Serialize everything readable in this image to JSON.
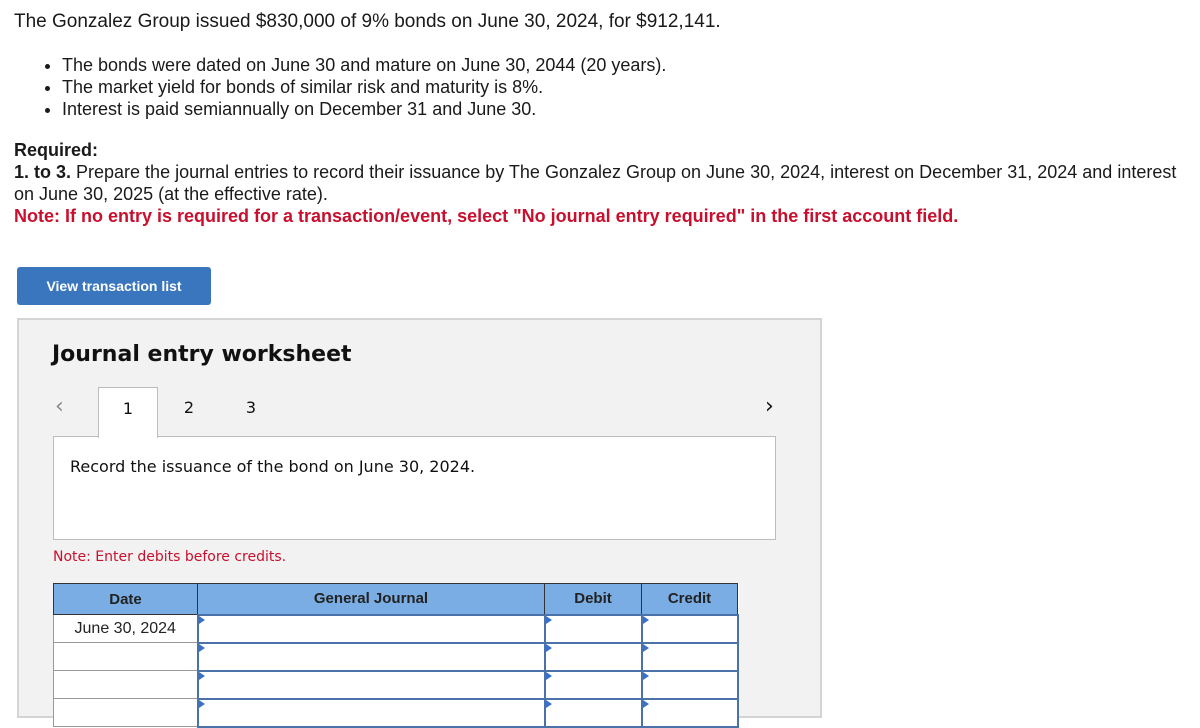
{
  "problem": {
    "intro": "The Gonzalez Group issued $830,000 of 9% bonds on June 30, 2024, for $912,141.",
    "bullets": [
      "The bonds were dated on June 30 and mature on June 30, 2044 (20 years).",
      "The market yield for bonds of similar risk and maturity is 8%.",
      "Interest is paid semiannually on December 31 and June 30."
    ],
    "required_label": "Required:",
    "step_label": "1. to 3.",
    "instruction": " Prepare the journal entries to record their issuance by The Gonzalez Group on June 30, 2024, interest on December 31, 2024 and interest on June 30, 2025 (at the effective rate).",
    "note": "Note: If no entry is required for a transaction/event, select \"No journal entry required\" in the first account field."
  },
  "buttons": {
    "view_transaction_list": "View transaction list"
  },
  "worksheet": {
    "title": "Journal entry worksheet",
    "prev_icon": "‹",
    "next_icon": "›",
    "tabs": [
      "1",
      "2",
      "3"
    ],
    "active_tab": "1",
    "description": "Record the issuance of the bond on June 30, 2024.",
    "enter_note": "Note: Enter debits before credits.",
    "table": {
      "headers": [
        "Date",
        "General Journal",
        "Debit",
        "Credit"
      ],
      "rows": [
        {
          "date": "June 30, 2024",
          "account": "",
          "debit": "",
          "credit": ""
        },
        {
          "date": "",
          "account": "",
          "debit": "",
          "credit": ""
        },
        {
          "date": "",
          "account": "",
          "debit": "",
          "credit": ""
        },
        {
          "date": "",
          "account": "",
          "debit": "",
          "credit": ""
        }
      ]
    }
  },
  "colors": {
    "button_blue": "#3a76bd",
    "header_blue": "#7aade3",
    "note_red": "#c8102e"
  }
}
